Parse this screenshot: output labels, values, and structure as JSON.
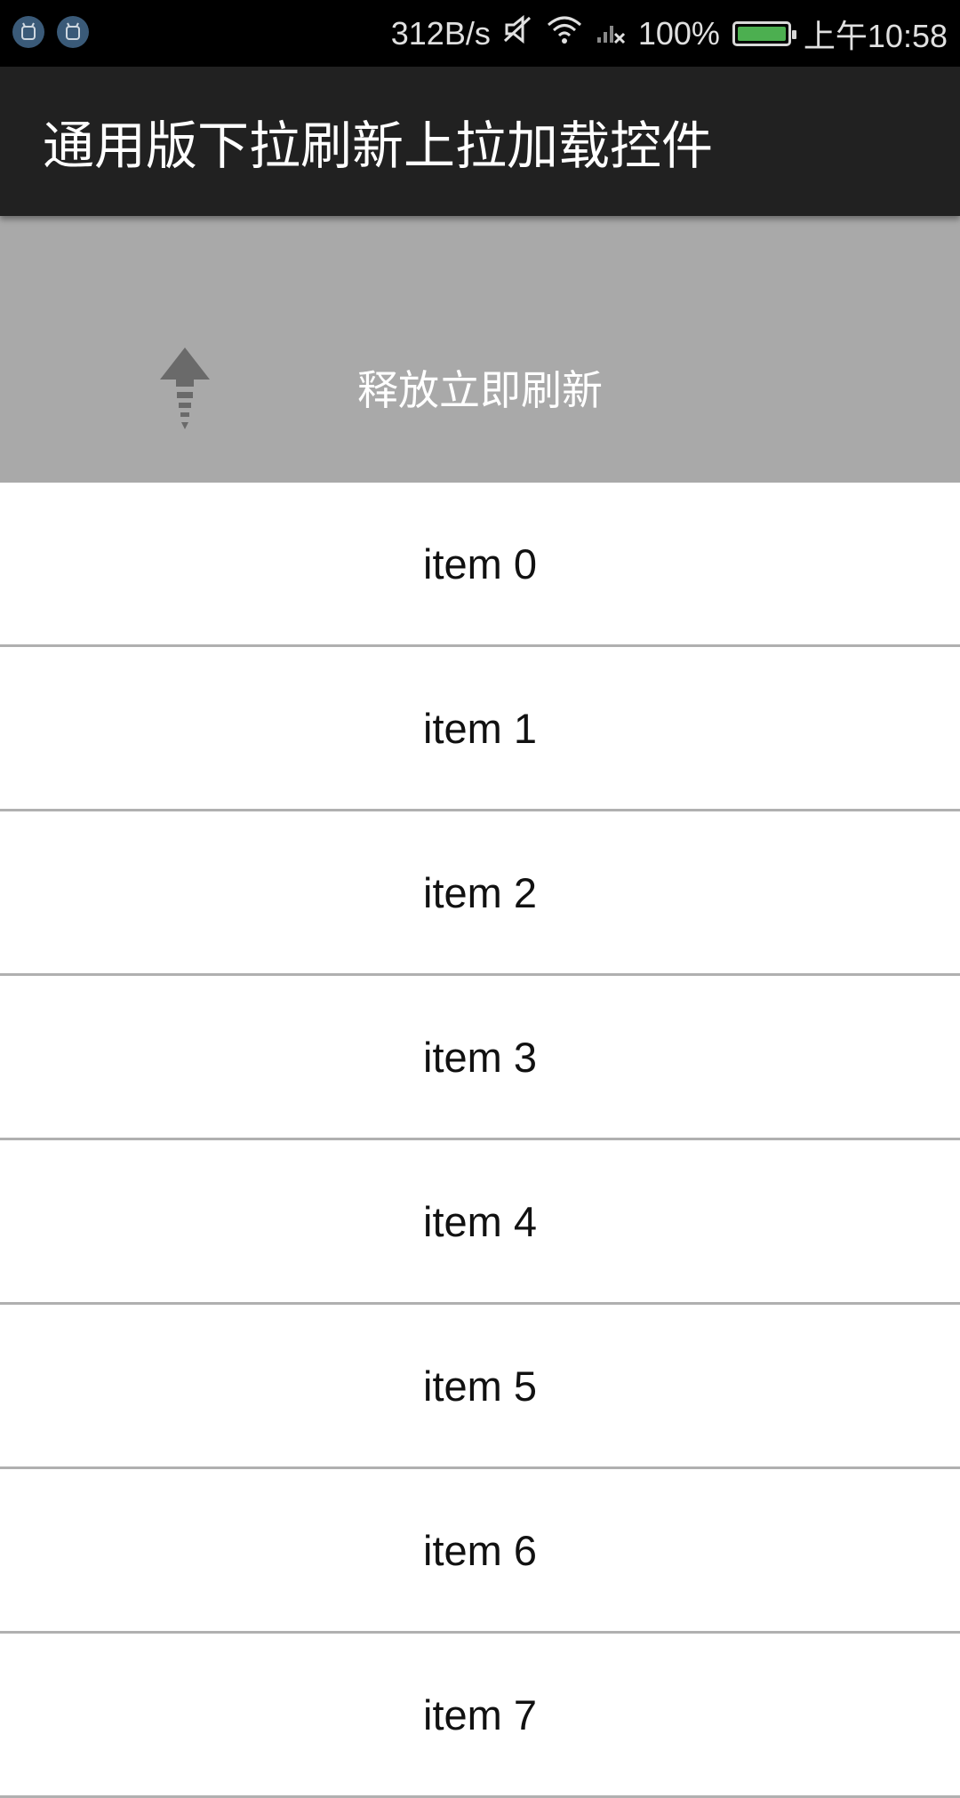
{
  "status_bar": {
    "net_speed": "312B/s",
    "battery_percent": "100%",
    "time": "上午10:58",
    "icons": [
      "android-icon",
      "android-icon",
      "mute-icon",
      "wifi-icon",
      "signal-icon",
      "battery-icon"
    ]
  },
  "app_bar": {
    "title": "通用版下拉刷新上拉加载控件"
  },
  "refresh_header": {
    "text": "释放立即刷新",
    "icon": "arrow-up-icon"
  },
  "list": {
    "items": [
      "item 0",
      "item 1",
      "item 2",
      "item 3",
      "item 4",
      "item 5",
      "item 6",
      "item 7"
    ]
  },
  "colors": {
    "status_bar_bg": "#000000",
    "app_bar_bg": "#212121",
    "refresh_header_bg": "#a9a9a9",
    "divider": "#b0b0b0",
    "battery_fill": "#4caf50"
  }
}
